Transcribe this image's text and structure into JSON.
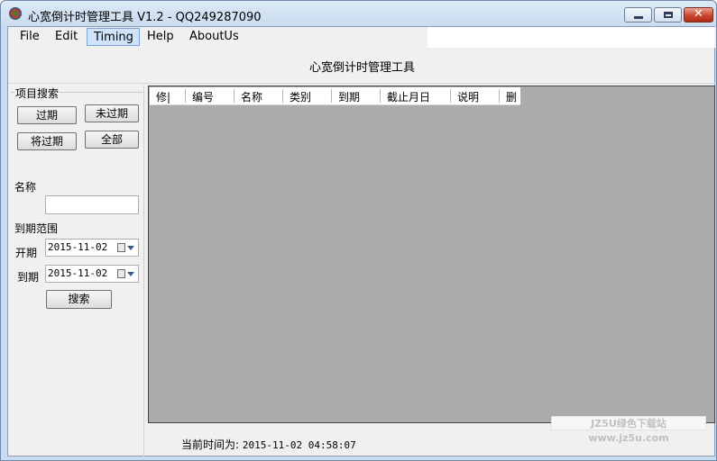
{
  "window": {
    "title": "心宽倒计时管理工具 V1.2 - QQ249287090",
    "app_icon": "app-logo-icon"
  },
  "menu": {
    "items": [
      {
        "label": "File"
      },
      {
        "label": "Edit"
      },
      {
        "label": "Timing",
        "active": true
      },
      {
        "label": "Help"
      },
      {
        "label": "AboutUs"
      }
    ]
  },
  "header": {
    "title": "心宽倒计时管理工具"
  },
  "search_panel": {
    "group_label": "项目搜索",
    "filter_buttons": {
      "expired": "过期",
      "not_expired": "未过期",
      "expiring": "将过期",
      "all": "全部"
    },
    "name_label": "名称",
    "name_value": "",
    "range_label": "到期范围",
    "start_label": "开期",
    "start_date": "2015-11-02",
    "end_label": "到期",
    "end_date": "2015-11-02",
    "search_button": "搜索"
  },
  "table": {
    "columns": [
      "修|",
      "编号",
      "名称",
      "类别",
      "到期",
      "截止月日",
      "说明",
      "删"
    ],
    "rows": []
  },
  "status": {
    "label": "当前时间为:",
    "time": "2015-11-02 04:58:07"
  },
  "watermark": "JZ5U绿色下载站www.jz5u.com",
  "colors": {
    "grid_background": "#ababab",
    "active_menu": "#cfe4fa",
    "close_button": "#c8452f"
  }
}
